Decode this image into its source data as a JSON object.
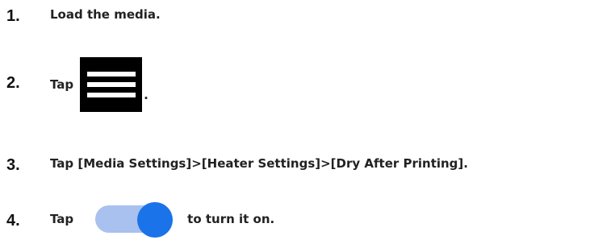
{
  "steps": [
    {
      "number": "1.",
      "text": "Load the media."
    },
    {
      "number": "2.",
      "text_before": "Tap",
      "text_after": ".",
      "icon": "menu-icon"
    },
    {
      "number": "3.",
      "text": "Tap [Media Settings]>[Heater Settings]>[Dry After Printing]."
    },
    {
      "number": "4.",
      "text_before": "Tap",
      "text_after": "to turn it on.",
      "icon": "toggle-switch-on-icon"
    }
  ],
  "colors": {
    "menu_icon_bg": "#000000",
    "toggle_track": "#a8c1ee",
    "toggle_knob": "#1a73e8"
  }
}
